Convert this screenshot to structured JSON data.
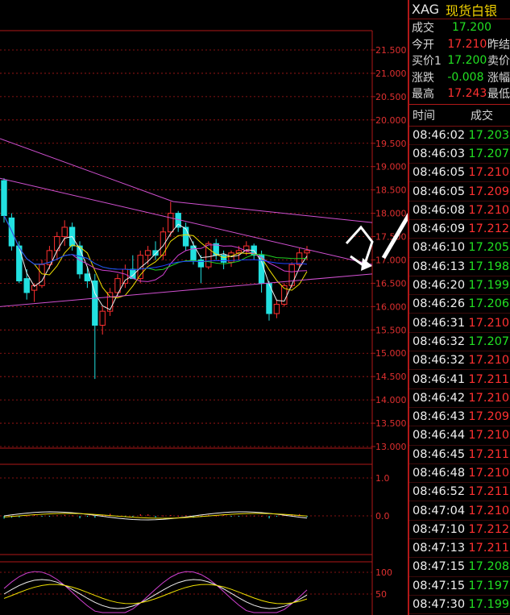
{
  "header": {
    "symbol": "XAG",
    "name": "现货白银"
  },
  "quote": [
    {
      "label": "成交",
      "value": "17.200",
      "color": "green",
      "label2": ""
    },
    {
      "label": "今开",
      "value": "17.210",
      "color": "red",
      "label2": "昨结"
    },
    {
      "label": "买价1",
      "value": "17.200",
      "color": "green",
      "label2": "卖价"
    },
    {
      "label": "涨跌",
      "value": "-0.008",
      "color": "green",
      "label2": "涨幅"
    },
    {
      "label": "最高",
      "value": "17.243",
      "color": "red",
      "label2": "最低"
    }
  ],
  "ticks_header": {
    "time": "时间",
    "price": "成交"
  },
  "ticks": [
    {
      "time": "08:46:02",
      "price": "17.203",
      "color": "green"
    },
    {
      "time": "08:46:03",
      "price": "17.207",
      "color": "green"
    },
    {
      "time": "08:46:05",
      "price": "17.210",
      "color": "red"
    },
    {
      "time": "08:46:05",
      "price": "17.209",
      "color": "red"
    },
    {
      "time": "08:46:08",
      "price": "17.210",
      "color": "red"
    },
    {
      "time": "08:46:09",
      "price": "17.212",
      "color": "red"
    },
    {
      "time": "08:46:10",
      "price": "17.205",
      "color": "green"
    },
    {
      "time": "08:46:13",
      "price": "17.198",
      "color": "green"
    },
    {
      "time": "08:46:20",
      "price": "17.199",
      "color": "green"
    },
    {
      "time": "08:46:26",
      "price": "17.206",
      "color": "green"
    },
    {
      "time": "08:46:31",
      "price": "17.210",
      "color": "red"
    },
    {
      "time": "08:46:32",
      "price": "17.207",
      "color": "green"
    },
    {
      "time": "08:46:32",
      "price": "17.210",
      "color": "red"
    },
    {
      "time": "08:46:41",
      "price": "17.211",
      "color": "red"
    },
    {
      "time": "08:46:42",
      "price": "17.210",
      "color": "red"
    },
    {
      "time": "08:46:43",
      "price": "17.209",
      "color": "red"
    },
    {
      "time": "08:46:44",
      "price": "17.210",
      "color": "red"
    },
    {
      "time": "08:46:45",
      "price": "17.211",
      "color": "red"
    },
    {
      "time": "08:46:48",
      "price": "17.210",
      "color": "red"
    },
    {
      "time": "08:46:52",
      "price": "17.211",
      "color": "red"
    },
    {
      "time": "08:47:04",
      "price": "17.210",
      "color": "red"
    },
    {
      "time": "08:47:10",
      "price": "17.212",
      "color": "red"
    },
    {
      "time": "08:47:13",
      "price": "17.211",
      "color": "red"
    },
    {
      "time": "08:47:15",
      "price": "17.208",
      "color": "green"
    },
    {
      "time": "08:47:15",
      "price": "17.197",
      "color": "green"
    },
    {
      "time": "08:47:30",
      "price": "17.199",
      "color": "green"
    }
  ],
  "colors": {
    "up": "#ff3030",
    "down": "#22e0e0",
    "grid": "#b01818",
    "axis_text": "#e03030"
  },
  "chart_data": {
    "type": "candlestick",
    "price_axis": {
      "ticks": [
        "21.500",
        "21.000",
        "20.500",
        "20.000",
        "19.500",
        "19.000",
        "18.500",
        "18.000",
        "17.500",
        "17.000",
        "16.500",
        "16.000",
        "15.500",
        "15.000",
        "14.500",
        "14.000",
        "13.500",
        "13.000"
      ],
      "range": [
        13.0,
        22.0
      ]
    },
    "candles": [
      {
        "o": 18.7,
        "h": 18.75,
        "l": 17.8,
        "c": 17.95
      },
      {
        "o": 17.9,
        "h": 18.0,
        "l": 17.2,
        "c": 17.3
      },
      {
        "o": 17.3,
        "h": 17.4,
        "l": 16.5,
        "c": 16.55
      },
      {
        "o": 16.6,
        "h": 16.8,
        "l": 16.15,
        "c": 16.3
      },
      {
        "o": 16.35,
        "h": 16.5,
        "l": 16.1,
        "c": 16.45
      },
      {
        "o": 16.45,
        "h": 17.0,
        "l": 16.4,
        "c": 16.9
      },
      {
        "o": 16.9,
        "h": 17.3,
        "l": 16.8,
        "c": 17.2
      },
      {
        "o": 17.2,
        "h": 17.6,
        "l": 17.0,
        "c": 17.5
      },
      {
        "o": 17.5,
        "h": 17.85,
        "l": 17.3,
        "c": 17.7
      },
      {
        "o": 17.7,
        "h": 17.8,
        "l": 17.2,
        "c": 17.3
      },
      {
        "o": 17.3,
        "h": 17.4,
        "l": 16.6,
        "c": 16.7
      },
      {
        "o": 16.7,
        "h": 16.85,
        "l": 16.4,
        "c": 16.55
      },
      {
        "o": 16.55,
        "h": 16.7,
        "l": 14.45,
        "c": 15.6
      },
      {
        "o": 15.6,
        "h": 16.0,
        "l": 15.4,
        "c": 15.9
      },
      {
        "o": 15.9,
        "h": 16.4,
        "l": 15.8,
        "c": 16.3
      },
      {
        "o": 16.3,
        "h": 16.7,
        "l": 16.2,
        "c": 16.6
      },
      {
        "o": 16.5,
        "h": 16.9,
        "l": 16.4,
        "c": 16.8
      },
      {
        "o": 16.8,
        "h": 17.1,
        "l": 16.6,
        "c": 16.6
      },
      {
        "o": 16.6,
        "h": 17.2,
        "l": 16.5,
        "c": 17.1
      },
      {
        "o": 17.1,
        "h": 17.3,
        "l": 16.9,
        "c": 17.2
      },
      {
        "o": 17.2,
        "h": 17.4,
        "l": 17.0,
        "c": 17.1
      },
      {
        "o": 17.1,
        "h": 17.7,
        "l": 17.0,
        "c": 17.6
      },
      {
        "o": 17.6,
        "h": 18.25,
        "l": 17.5,
        "c": 18.0
      },
      {
        "o": 18.0,
        "h": 18.05,
        "l": 17.6,
        "c": 17.7
      },
      {
        "o": 17.7,
        "h": 17.8,
        "l": 17.2,
        "c": 17.3
      },
      {
        "o": 17.3,
        "h": 17.4,
        "l": 16.9,
        "c": 17.0
      },
      {
        "o": 17.0,
        "h": 17.1,
        "l": 16.5,
        "c": 16.85
      },
      {
        "o": 16.85,
        "h": 17.4,
        "l": 16.8,
        "c": 17.35
      },
      {
        "o": 17.35,
        "h": 17.45,
        "l": 17.0,
        "c": 17.1
      },
      {
        "o": 17.1,
        "h": 17.2,
        "l": 16.8,
        "c": 16.95
      },
      {
        "o": 16.95,
        "h": 17.2,
        "l": 16.85,
        "c": 17.15
      },
      {
        "o": 17.15,
        "h": 17.3,
        "l": 17.0,
        "c": 17.2
      },
      {
        "o": 17.2,
        "h": 17.4,
        "l": 17.1,
        "c": 17.3
      },
      {
        "o": 17.3,
        "h": 17.35,
        "l": 17.0,
        "c": 17.1
      },
      {
        "o": 17.1,
        "h": 17.2,
        "l": 16.3,
        "c": 16.5
      },
      {
        "o": 16.5,
        "h": 16.55,
        "l": 15.7,
        "c": 15.85
      },
      {
        "o": 15.85,
        "h": 16.15,
        "l": 15.75,
        "c": 16.05
      },
      {
        "o": 16.05,
        "h": 16.5,
        "l": 16.0,
        "c": 16.45
      },
      {
        "o": 16.45,
        "h": 16.95,
        "l": 16.4,
        "c": 16.9
      },
      {
        "o": 16.9,
        "h": 17.25,
        "l": 16.85,
        "c": 17.15
      },
      {
        "o": 17.15,
        "h": 17.3,
        "l": 17.0,
        "c": 17.2
      }
    ],
    "macd_axis": {
      "ticks": [
        "1.0",
        "0.0"
      ]
    },
    "kdj_axis": {
      "ticks": [
        "100",
        "50"
      ]
    }
  }
}
